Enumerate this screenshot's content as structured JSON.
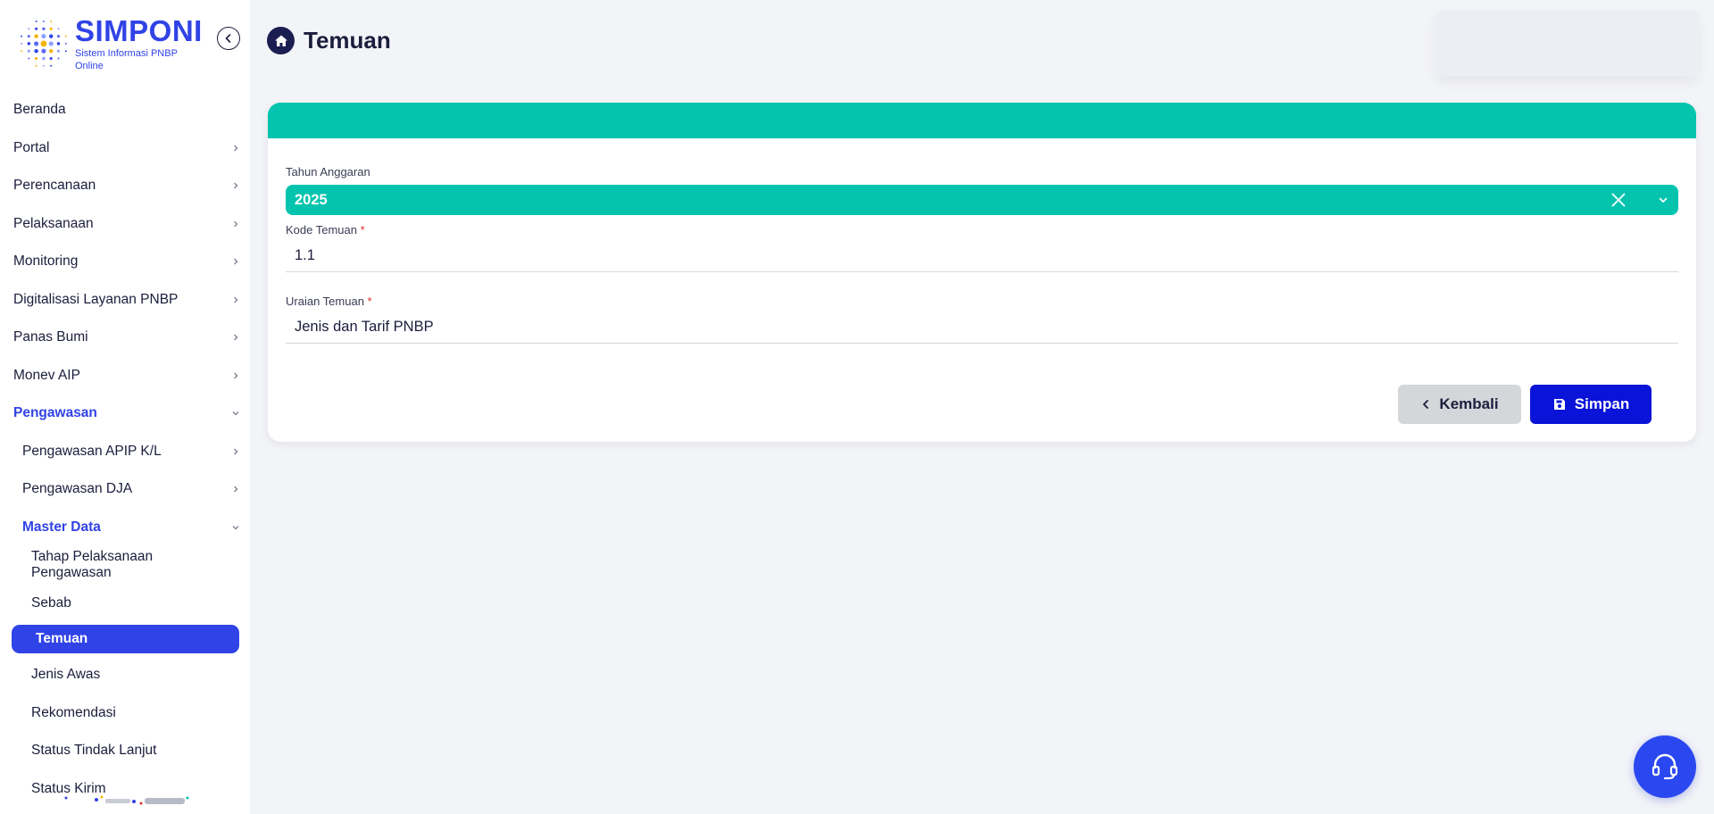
{
  "brand": {
    "title": "SIMPONI",
    "subtitle": "Sistem Informasi PNBP Online",
    "accent_color": "#3043e6",
    "teal_color": "#05c4ae"
  },
  "sidebar": {
    "collapse_icon": "chevron-left-circle-icon",
    "items": [
      {
        "label": "Beranda"
      },
      {
        "label": "Portal"
      },
      {
        "label": "Perencanaan"
      },
      {
        "label": "Pelaksanaan"
      },
      {
        "label": "Monitoring"
      },
      {
        "label": "Digitalisasi Layanan PNBP"
      },
      {
        "label": "Panas Bumi"
      },
      {
        "label": "Monev AIP"
      },
      {
        "label": "Pengawasan"
      },
      {
        "label": "Pengawasan APIP K/L"
      },
      {
        "label": "Pengawasan DJA"
      },
      {
        "label": "Master Data"
      },
      {
        "label": "Tahap Pelaksanaan Pengawasan"
      },
      {
        "label": "Sebab"
      },
      {
        "label": "Temuan"
      },
      {
        "label": "Jenis Awas"
      },
      {
        "label": "Rekomendasi"
      },
      {
        "label": "Status Tindak Lanjut"
      },
      {
        "label": "Status Kirim"
      }
    ]
  },
  "page": {
    "title": "Temuan",
    "icon": "home-icon"
  },
  "form": {
    "tahun_anggaran": {
      "label": "Tahun Anggaran",
      "value": "2025"
    },
    "kode_temuan": {
      "label": "Kode Temuan",
      "required_mark": "*",
      "value": "1.1"
    },
    "uraian_temuan": {
      "label": "Uraian Temuan",
      "required_mark": "*",
      "value": "Jenis dan Tarif PNBP"
    },
    "back_label": "Kembali",
    "save_label": "Simpan"
  },
  "help": {
    "icon": "headset-icon"
  }
}
